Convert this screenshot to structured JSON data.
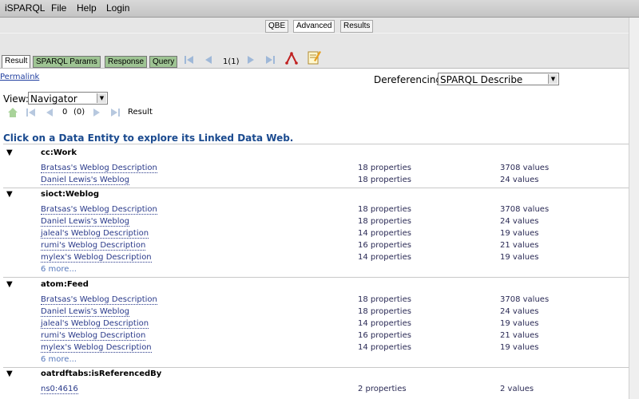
{
  "menubar": {
    "items": [
      "iSPARQL",
      "File",
      "Help",
      "Login"
    ]
  },
  "modes": [
    "QBE",
    "Advanced",
    "Results"
  ],
  "tabs": [
    "Result",
    "SPARQL Params",
    "Response",
    "Query"
  ],
  "pager": {
    "text": "1(1)"
  },
  "permalink": "Permalink",
  "dereferencing": {
    "label": "Dereferencing:",
    "value": "SPARQL Describe"
  },
  "view": {
    "label": "View:",
    "value": "Navigator"
  },
  "nav": {
    "pos": "0",
    "count": "(0)",
    "result_label": "Result"
  },
  "heading": "Click on a Data Entity to explore its Linked Data Web.",
  "groups": [
    {
      "title": "cc:Work",
      "rows": [
        {
          "name": "Bratsas's Weblog Description",
          "props": "18 properties",
          "vals": "3708 values"
        },
        {
          "name": "Daniel Lewis's Weblog",
          "props": "18 properties",
          "vals": "24 values"
        }
      ]
    },
    {
      "title": "sioct:Weblog",
      "rows": [
        {
          "name": "Bratsas's Weblog Description",
          "props": "18 properties",
          "vals": "3708 values"
        },
        {
          "name": "Daniel Lewis's Weblog",
          "props": "18 properties",
          "vals": "24 values"
        },
        {
          "name": "jaleal's Weblog Description",
          "props": "14 properties",
          "vals": "19 values"
        },
        {
          "name": "rumi's Weblog Description",
          "props": "16 properties",
          "vals": "21 values"
        },
        {
          "name": "mylex's Weblog Description",
          "props": "14 properties",
          "vals": "19 values"
        }
      ],
      "more": "6 more..."
    },
    {
      "title": "atom:Feed",
      "rows": [
        {
          "name": "Bratsas's Weblog Description",
          "props": "18 properties",
          "vals": "3708 values"
        },
        {
          "name": "Daniel Lewis's Weblog",
          "props": "18 properties",
          "vals": "24 values"
        },
        {
          "name": "jaleal's Weblog Description",
          "props": "14 properties",
          "vals": "19 values"
        },
        {
          "name": "rumi's Weblog Description",
          "props": "16 properties",
          "vals": "21 values"
        },
        {
          "name": "mylex's Weblog Description",
          "props": "14 properties",
          "vals": "19 values"
        }
      ],
      "more": "6 more..."
    },
    {
      "title": "oatrdftabs:isReferencedBy",
      "rows": [
        {
          "name": "ns0:4616",
          "props": "2 properties",
          "vals": "2 values"
        }
      ]
    }
  ]
}
